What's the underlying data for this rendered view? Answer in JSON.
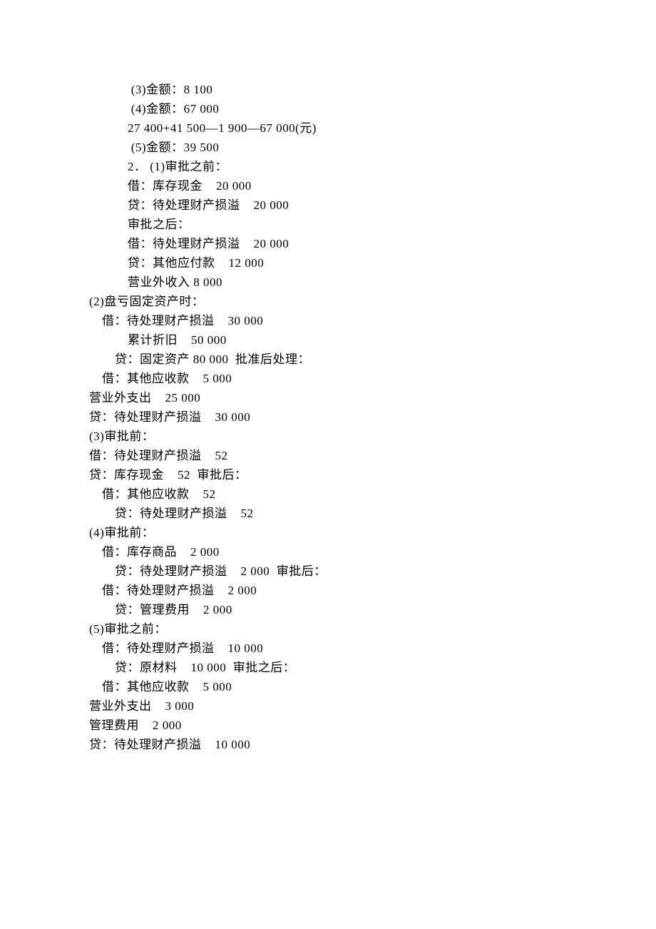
{
  "lines": [
    {
      "cls": "i1",
      "text": " (3)金额：8 100"
    },
    {
      "cls": "i1",
      "text": " (4)金额：67 000"
    },
    {
      "cls": "i1",
      "text": "27 400+41 500—1 900—67 000(元)"
    },
    {
      "cls": "i1",
      "text": " (5)金额：39 500"
    },
    {
      "cls": "i1",
      "text": "2． (1)审批之前："
    },
    {
      "cls": "i1",
      "text": "借：库存现金    20 000"
    },
    {
      "cls": "i1",
      "text": "贷：待处理财产损溢    20 000"
    },
    {
      "cls": "i1",
      "text": "审批之后："
    },
    {
      "cls": "i1",
      "text": "借：待处理财产损溢    20 000"
    },
    {
      "cls": "i1",
      "text": "贷：其他应付款    12 000"
    },
    {
      "cls": "i1",
      "text": "营业外收入 8 000"
    },
    {
      "cls": "",
      "text": "(2)盘亏固定资产时："
    },
    {
      "cls": "i2",
      "text": "借：待处理财产损溢    30 000"
    },
    {
      "cls": "i1",
      "text": "累计折旧    50 000"
    },
    {
      "cls": "i3",
      "text": "贷：固定资产 80 000  批准后处理："
    },
    {
      "cls": "i2",
      "text": "借：其他应收款    5 000"
    },
    {
      "cls": "",
      "text": "营业外支出    25 000"
    },
    {
      "cls": "",
      "text": "贷：待处理财产损溢    30 000"
    },
    {
      "cls": "",
      "text": "(3)审批前："
    },
    {
      "cls": "",
      "text": "借：待处理财产损溢    52"
    },
    {
      "cls": "",
      "text": "贷：库存现金    52  审批后："
    },
    {
      "cls": "i2",
      "text": "借：其他应收款    52"
    },
    {
      "cls": "i3",
      "text": "贷：待处理财产损溢    52"
    },
    {
      "cls": "",
      "text": "(4)审批前："
    },
    {
      "cls": "i2",
      "text": "借：库存商品    2 000"
    },
    {
      "cls": "i3",
      "text": "贷：待处理财产损溢    2 000  审批后："
    },
    {
      "cls": "i2",
      "text": "借：待处理财产损溢    2 000"
    },
    {
      "cls": "i3",
      "text": "贷：管理费用    2 000"
    },
    {
      "cls": "",
      "text": "(5)审批之前："
    },
    {
      "cls": "i2",
      "text": "借：待处理财产损溢    10 000"
    },
    {
      "cls": "i3",
      "text": "贷：原材料    10 000  审批之后："
    },
    {
      "cls": "i2",
      "text": "借：其他应收款    5 000"
    },
    {
      "cls": "",
      "text": "营业外支出    3 000"
    },
    {
      "cls": "",
      "text": "管理费用    2 000"
    },
    {
      "cls": "",
      "text": "贷：待处理财产损溢    10 000"
    }
  ]
}
